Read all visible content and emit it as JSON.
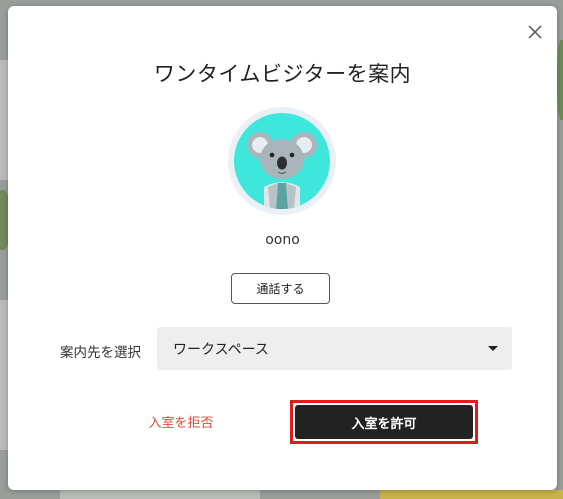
{
  "dialog": {
    "title": "ワンタイムビジターを案内",
    "close_icon": "close-icon",
    "visitor": {
      "avatar_icon": "koala-avatar",
      "name": "oono"
    },
    "call_button_label": "通話する",
    "destination": {
      "label": "案内先を選択",
      "selected": "ワークスペース"
    },
    "deny_button_label": "入室を拒否",
    "allow_button_label": "入室を許可"
  },
  "colors": {
    "avatar_bg": "#3fe6db",
    "deny_text": "#e04a3a",
    "allow_bg": "#222222",
    "highlight_border": "#e01b1b"
  }
}
